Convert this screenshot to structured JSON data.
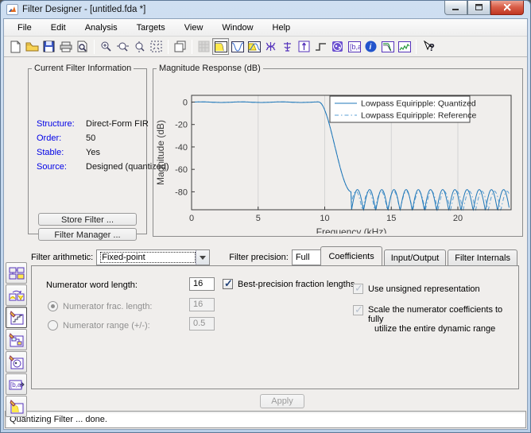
{
  "window": {
    "title": "Filter Designer -  [untitled.fda *]",
    "caption_buttons": [
      "minimize",
      "maximize",
      "close"
    ]
  },
  "menu": {
    "items": [
      "File",
      "Edit",
      "Analysis",
      "Targets",
      "View",
      "Window",
      "Help"
    ]
  },
  "toolbar": {
    "items": [
      {
        "name": "new-session"
      },
      {
        "name": "open-session"
      },
      {
        "name": "save-session"
      },
      {
        "name": "print"
      },
      {
        "name": "print-preview"
      },
      {
        "sep": true
      },
      {
        "name": "zoom-in"
      },
      {
        "name": "zoom-x"
      },
      {
        "name": "zoom-y"
      },
      {
        "name": "full-view"
      },
      {
        "sep": true
      },
      {
        "name": "print-to-figure"
      },
      {
        "sep": true
      },
      {
        "name": "filterbuilder",
        "disabled": true
      },
      {
        "name": "magnitude-response",
        "selected": true
      },
      {
        "name": "phase-response"
      },
      {
        "name": "magnitude-phase-response"
      },
      {
        "name": "group-delay"
      },
      {
        "name": "phase-delay"
      },
      {
        "name": "impulse-response"
      },
      {
        "name": "step-response"
      },
      {
        "name": "pole-zero-plot"
      },
      {
        "name": "filter-coefficients"
      },
      {
        "name": "filter-information"
      },
      {
        "name": "magnitude-response-estimate"
      },
      {
        "name": "round-off-noise-psd"
      },
      {
        "sep": true
      },
      {
        "name": "whats-this-help"
      }
    ]
  },
  "info_panel": {
    "title": "Current Filter Information",
    "label_color": "#0000e6",
    "fields": [
      {
        "label": "Structure:",
        "value": "Direct-Form FIR"
      },
      {
        "label": "Order:",
        "value": "50"
      },
      {
        "label": "Stable:",
        "value": "Yes"
      },
      {
        "label": "Source:",
        "value": "Designed (quantized)"
      }
    ],
    "buttons": {
      "store": "Store Filter ...",
      "manager": "Filter Manager ..."
    }
  },
  "chart_data": {
    "type": "line",
    "title": "Magnitude Response (dB)",
    "xlabel": "Frequency (kHz)",
    "ylabel": "Magnitude (dB)",
    "xlim": [
      0,
      24
    ],
    "ylim": [
      -96,
      6
    ],
    "xticks": [
      0,
      5,
      10,
      15,
      20
    ],
    "yticks": [
      0,
      -20,
      -40,
      -60,
      -80
    ],
    "grid": "vertical",
    "legend_position": "top-right",
    "series": [
      {
        "name": "Lowpass Equiripple: Quantized",
        "style": "solid",
        "color": "#1f77b8",
        "model": {
          "passband_level_dB": 0,
          "passband_edge_kHz": 9.55,
          "stopband_edge_kHz": 12,
          "stopband_peak_dB": -78,
          "null_floor_dB": -97,
          "lobe_width_kHz": 0.915,
          "phase_kHz": 0
        }
      },
      {
        "name": "Lowpass Equiripple: Reference",
        "style": "dash-dot",
        "color": "#5a9fd4",
        "model": {
          "passband_level_dB": 0,
          "passband_edge_kHz": 9.55,
          "stopband_edge_kHz": 12,
          "stopband_peak_dB": -79.5,
          "null_floor_dB": -97,
          "lobe_width_kHz": 0.945,
          "phase_kHz": 0.12
        }
      }
    ]
  },
  "sidebar": {
    "items": [
      {
        "name": "multirate-filter"
      },
      {
        "name": "transform-filter"
      },
      {
        "name": "set-quantization-parameters",
        "selected": true
      },
      {
        "name": "realize-model"
      },
      {
        "name": "pole-zero-editor"
      },
      {
        "name": "import-filter"
      },
      {
        "name": "design-filter"
      }
    ]
  },
  "quant_panel": {
    "arith_label": "Filter arithmetic:",
    "arith_value": "Fixed-point",
    "precision_label": "Filter precision:",
    "precision_value": "Full",
    "tabs": [
      {
        "label": "Coefficients",
        "active": true
      },
      {
        "label": "Input/Output",
        "active": false
      },
      {
        "label": "Filter Internals",
        "active": false
      }
    ],
    "numerator_word_label": "Numerator word length:",
    "numerator_word_value": "16",
    "best_precision_label": "Best-precision fraction lengths",
    "best_precision_checked": true,
    "frac_length_label": "Numerator frac. length:",
    "frac_length_value": "16",
    "range_label": "Numerator range (+/-):",
    "range_value": "0.5",
    "unsigned_label": "Use unsigned representation",
    "scale_label_line1": "Scale the numerator coefficients to fully",
    "scale_label_line2": "utilize the entire dynamic range",
    "apply_label": "Apply"
  },
  "status": {
    "text": "Quantizing Filter ... done."
  }
}
